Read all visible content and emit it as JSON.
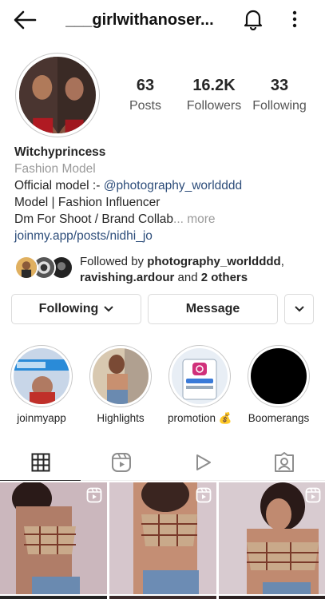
{
  "header": {
    "username": "___girlwithanoser...",
    "back_icon": "arrow-left-icon",
    "notification_icon": "bell-icon",
    "menu_icon": "more-vertical-icon"
  },
  "stats": {
    "posts": {
      "value": "63",
      "label": "Posts"
    },
    "followers": {
      "value": "16.2K",
      "label": "Followers"
    },
    "following": {
      "value": "33",
      "label": "Following"
    }
  },
  "bio": {
    "name": "Witchyprincess",
    "category": "Fashion Model",
    "line1_prefix": "Official model :- ",
    "line1_mention": "@photography_worldddd",
    "line2": "Model | Fashion Influencer",
    "line3": "Dm For Shoot / Brand Collab",
    "more": "... more",
    "link": "joinmy.app/posts/nidhi_jo"
  },
  "followed_by": {
    "prefix": "Followed by ",
    "user1": "photography_worldddd",
    "comma": ",",
    "user2": "ravishing.ardour",
    "and": " and ",
    "others": "2 others"
  },
  "buttons": {
    "following": "Following",
    "message": "Message"
  },
  "highlights": [
    {
      "label": "joinmyapp"
    },
    {
      "label": "Highlights"
    },
    {
      "label": "promotion 💰"
    },
    {
      "label": "Boomerangs"
    }
  ],
  "tabs": [
    "grid-icon",
    "reels-icon",
    "play-icon",
    "tagged-icon"
  ],
  "colors": {
    "link": "#2d4d7a",
    "muted": "#9a9a9a",
    "border": "#dbdbdb"
  }
}
